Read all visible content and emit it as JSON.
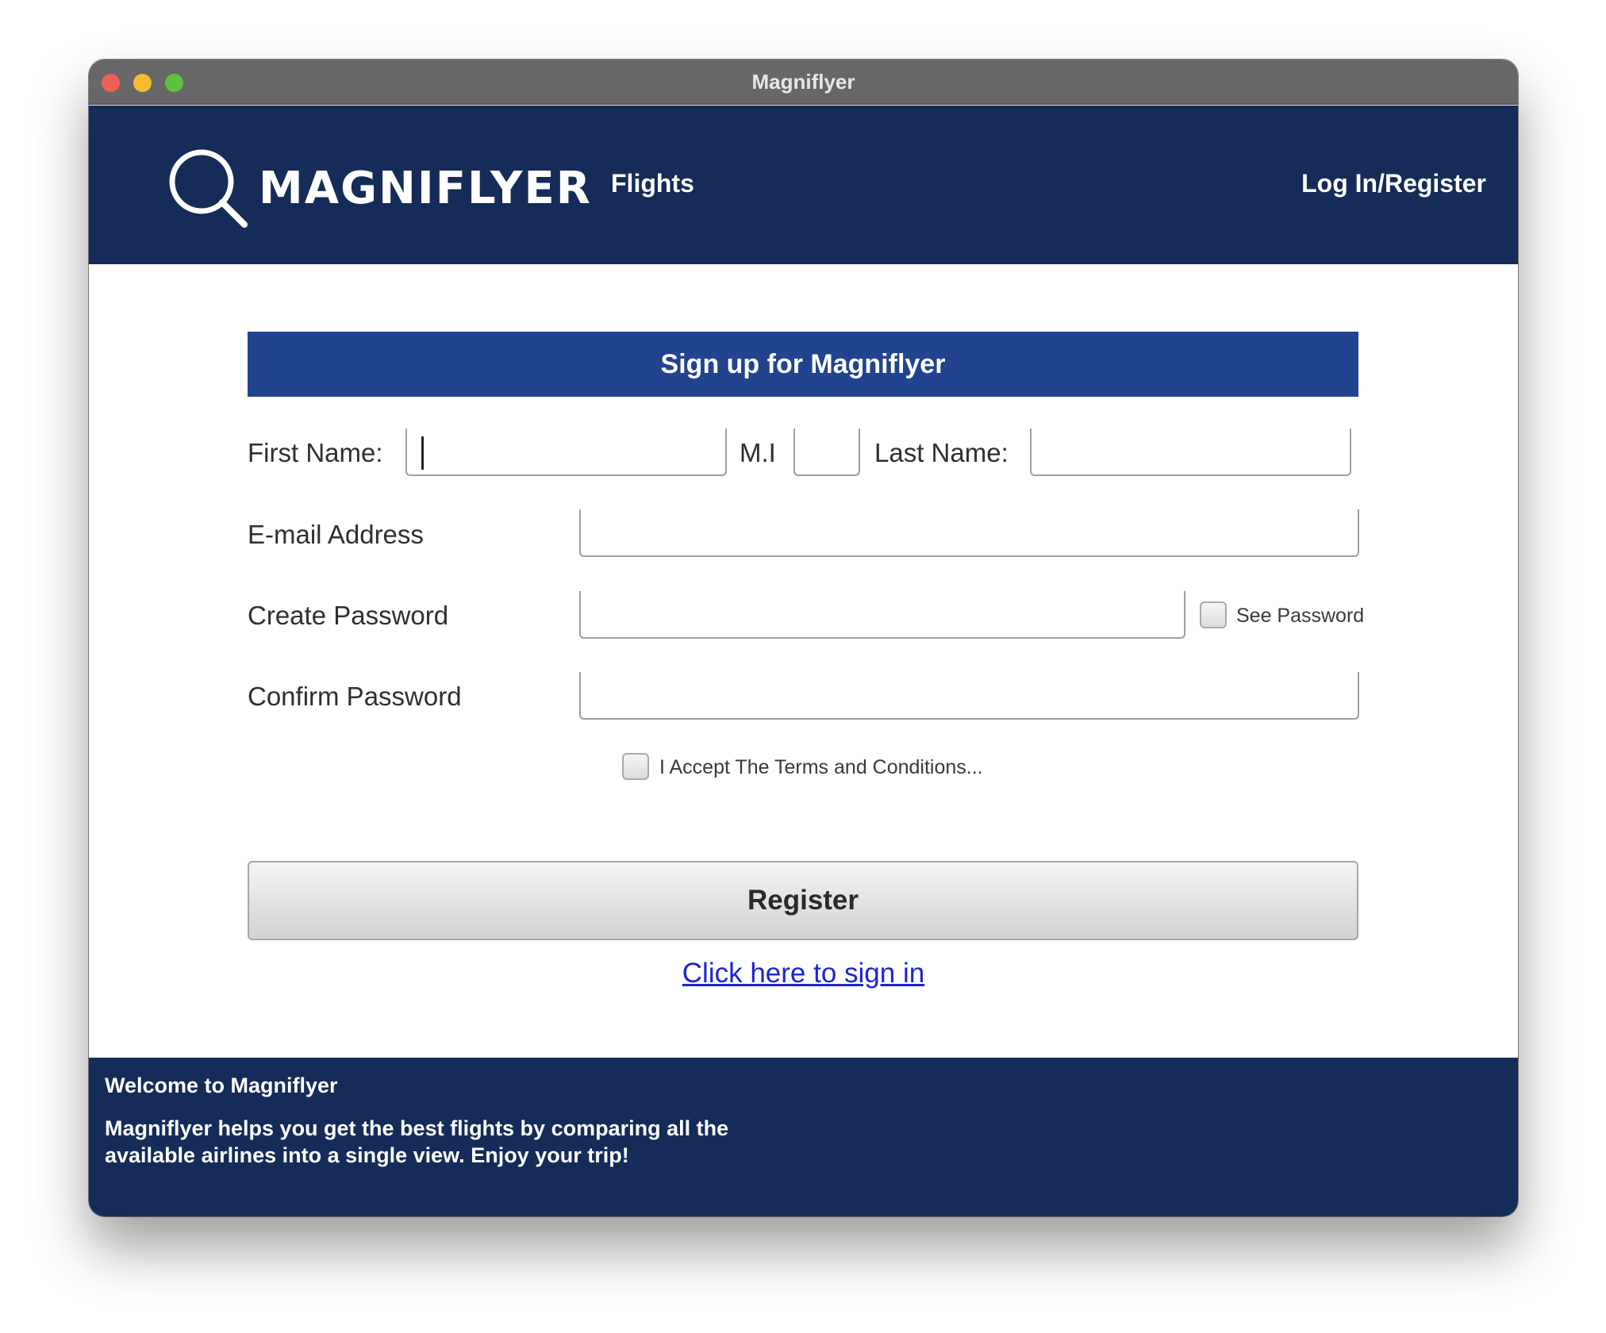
{
  "window": {
    "title": "Magniflyer"
  },
  "header": {
    "logo_text": "MAGNIFLYER",
    "nav_flights": "Flights",
    "nav_login": "Log In/Register"
  },
  "form": {
    "banner": "Sign up for Magniflyer",
    "first_name_label": "First Name:",
    "first_name_value": "",
    "mi_label": "M.I",
    "mi_value": "",
    "last_name_label": "Last Name:",
    "last_name_value": "",
    "email_label": "E-mail Address",
    "email_value": "",
    "create_password_label": "Create Password",
    "create_password_value": "",
    "see_password_label": "See Password",
    "see_password_checked": false,
    "confirm_password_label": "Confirm Password",
    "confirm_password_value": "",
    "terms_label": "I Accept The Terms and Conditions...",
    "terms_checked": false,
    "register_button": "Register",
    "signin_link": "Click here to sign in"
  },
  "footer": {
    "title": "Welcome to Magniflyer",
    "text": "Magniflyer helps you get the best flights by comparing all the available airlines into a single view. Enjoy your trip!"
  },
  "colors": {
    "header_bg": "#152b58",
    "banner_bg": "#22438e",
    "link": "#1b25d6",
    "close": "#ee5f57",
    "minimize": "#f5bd2e",
    "maximize": "#5ec23f"
  }
}
